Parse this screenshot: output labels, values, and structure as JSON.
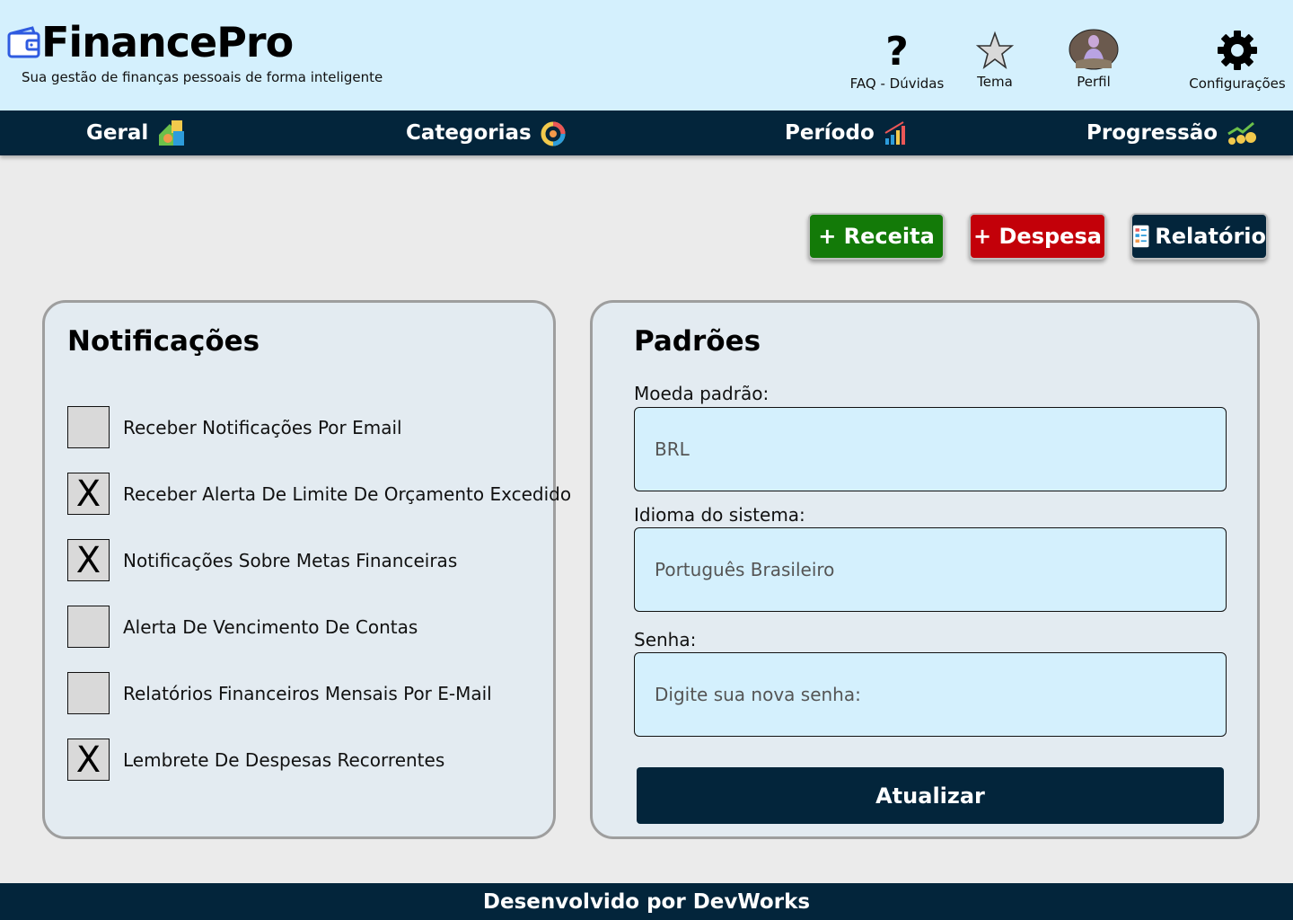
{
  "app": {
    "title": "FinancePro",
    "tagline": "Sua gestão de finanças pessoais de forma inteligente"
  },
  "top_actions": [
    {
      "label": "FAQ - Dúvidas",
      "icon": "question-mark-icon",
      "glyph": "?"
    },
    {
      "label": "Tema",
      "icon": "star-icon"
    },
    {
      "label": "Perfil",
      "icon": "avatar-photo"
    },
    {
      "label": "Configurações",
      "icon": "gear-icon"
    }
  ],
  "nav": [
    {
      "label": "Geral",
      "icon": "house-money-icon"
    },
    {
      "label": "Categorias",
      "icon": "donut-chart-icon"
    },
    {
      "label": "Período",
      "icon": "bar-growth-icon"
    },
    {
      "label": "Progressão",
      "icon": "coins-growth-icon"
    }
  ],
  "actions": {
    "receita": "+ Receita",
    "despesa": "+ Despesa",
    "relatorio": "Relatório"
  },
  "notificacoes": {
    "title": "Notificações",
    "items": [
      {
        "label": "Receber Notificações Por Email",
        "checked": false,
        "mark": ""
      },
      {
        "label": "Receber Alerta De Limite De Orçamento Excedido",
        "checked": true,
        "mark": "X"
      },
      {
        "label": "Notificações Sobre Metas Financeiras",
        "checked": true,
        "mark": "X"
      },
      {
        "label": "Alerta De Vencimento De Contas",
        "checked": false,
        "mark": ""
      },
      {
        "label": "Relatórios Financeiros Mensais Por E-Mail",
        "checked": false,
        "mark": ""
      },
      {
        "label": "Lembrete De Despesas Recorrentes",
        "checked": true,
        "mark": "X"
      }
    ]
  },
  "padroes": {
    "title": "Padrões",
    "moeda_label": "Moeda padrão:",
    "moeda_placeholder": "BRL",
    "idioma_label": "Idioma do sistema:",
    "idioma_placeholder": "Português Brasileiro",
    "senha_label": "Senha:",
    "senha_placeholder": "Digite sua nova senha:",
    "submit": "Atualizar"
  },
  "footer": {
    "text": "Desenvolvido por DevWorks"
  },
  "colors": {
    "header_bg": "#d4f0fd",
    "navy": "#03253b",
    "green": "#137a08",
    "red": "#c30009",
    "panel_bg": "#e3ebf1",
    "page_bg": "#ebebeb"
  }
}
